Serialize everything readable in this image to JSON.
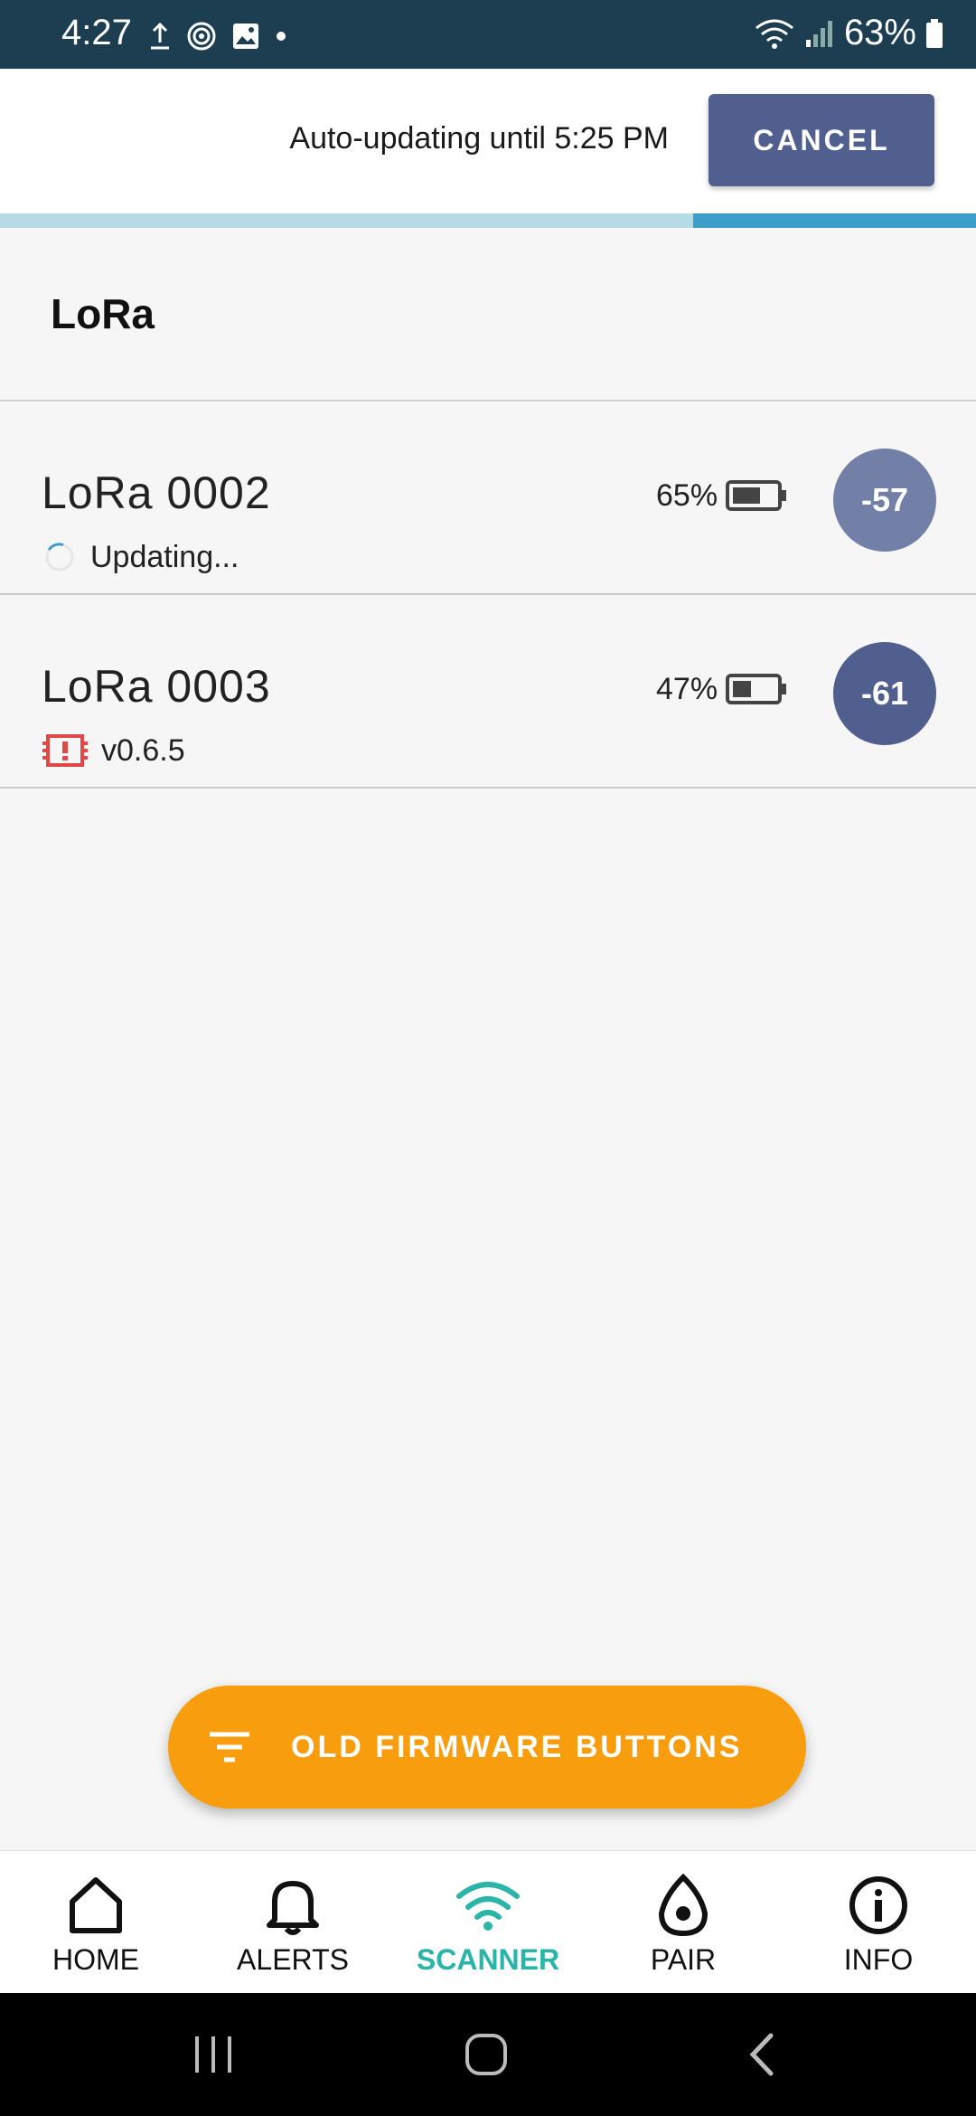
{
  "status_bar": {
    "time": "4:27",
    "battery": "63%",
    "icons": [
      "upload-icon",
      "radar-icon",
      "image-icon",
      "dot-icon",
      "wifi-icon",
      "signal-icon",
      "battery-icon"
    ]
  },
  "header": {
    "auto_update_text": "Auto-updating until 5:25 PM",
    "cancel_label": "CANCEL",
    "progress": 0.29
  },
  "section": {
    "title": "LoRa"
  },
  "devices": [
    {
      "name": "LoRa 0002",
      "status": "Updating...",
      "status_icon": "spinner-icon",
      "battery": "65%",
      "rssi": "-57",
      "rssi_color": "#7280a8"
    },
    {
      "name": "LoRa 0003",
      "status": "v0.6.5",
      "status_icon": "firmware-warning-icon",
      "battery": "47%",
      "rssi": "-61",
      "rssi_color": "#515f8e"
    }
  ],
  "fab": {
    "label": "OLD FIRMWARE BUTTONS",
    "icon": "filter-icon"
  },
  "nav": {
    "items": [
      {
        "label": "HOME",
        "icon": "home-icon"
      },
      {
        "label": "ALERTS",
        "icon": "bell-icon"
      },
      {
        "label": "SCANNER",
        "icon": "wifi-icon"
      },
      {
        "label": "PAIR",
        "icon": "pair-icon"
      },
      {
        "label": "INFO",
        "icon": "info-icon"
      }
    ],
    "active": "SCANNER"
  },
  "colors": {
    "status_bar": "#1d3d50",
    "cancel": "#515f8e",
    "fab": "#f89d0e",
    "active_nav": "#2ab5a8",
    "warning": "#e04848"
  }
}
